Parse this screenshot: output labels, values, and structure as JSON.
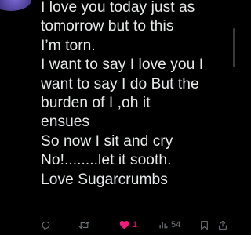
{
  "post": {
    "lines": [
      "I love you today just as",
      "tomorrow but to this",
      "I’m torn.",
      "I want to say I love you I",
      "want to say I do But the",
      "burden of I ,oh it",
      "ensues",
      "So now I sit and cry",
      "No!........let it sooth.",
      "Love Sugarcrumbs"
    ]
  },
  "actions": {
    "reply": {
      "icon": "reply-icon"
    },
    "repost": {
      "icon": "repost-icon"
    },
    "like": {
      "icon": "heart-icon",
      "count": "1",
      "liked": true,
      "color": "#f91880"
    },
    "views": {
      "icon": "views-icon",
      "count": "54"
    },
    "bookmark": {
      "icon": "bookmark-icon"
    },
    "share": {
      "icon": "share-icon"
    }
  },
  "colors": {
    "background": "#000000",
    "text": "#e7e9ea",
    "muted": "#71767b",
    "like": "#f91880"
  }
}
